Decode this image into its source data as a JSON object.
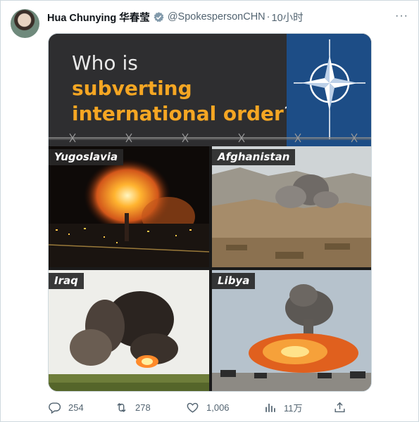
{
  "tweet": {
    "display_name": "Hua Chunying 华春莹",
    "handle": "@SpokespersonCHN",
    "separator": "·",
    "time": "10小时",
    "more": "···"
  },
  "image": {
    "title_line1": "Who is",
    "title_line2": "subverting",
    "title_line3": "international order",
    "title_qmark": "?",
    "panels": [
      {
        "label": "Yugoslavia"
      },
      {
        "label": "Afghanistan"
      },
      {
        "label": "Iraq"
      },
      {
        "label": "Libya"
      }
    ]
  },
  "actions": {
    "replies": "254",
    "retweets": "278",
    "likes": "1,006",
    "views": "11万"
  },
  "colors": {
    "accent_orange": "#f5a623",
    "nato_blue": "#1d4d86",
    "muted_text": "#536471",
    "verified": "#829aab"
  }
}
